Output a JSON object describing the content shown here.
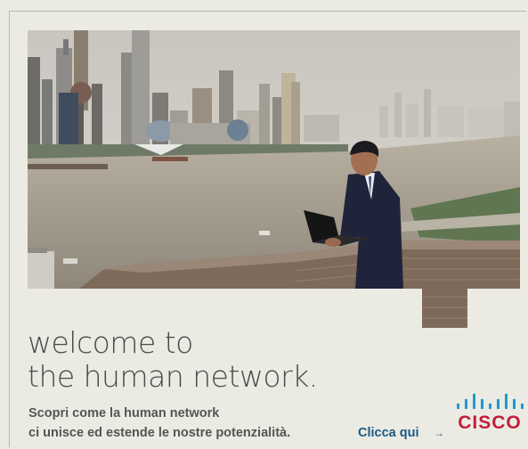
{
  "ad": {
    "headline": [
      "welcome to",
      "the human network."
    ],
    "body": [
      "Scopri come la human network",
      "ci unisce ed estende le nostre potenzialità."
    ],
    "cta_label": "Clicca qui",
    "cta_arrow": "→",
    "brand": "CISCO"
  },
  "colors": {
    "background": "#ebebe4",
    "headline": "#4a4a4a",
    "link": "#1a5a86",
    "brand": "#c41e3a"
  },
  "icons": [
    "arrow-right-icon",
    "cisco-logo"
  ]
}
